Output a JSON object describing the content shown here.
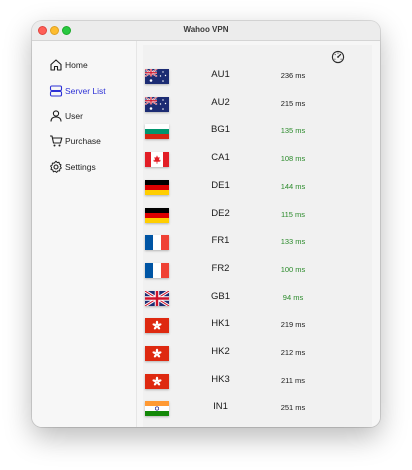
{
  "window": {
    "title": "Wahoo VPN"
  },
  "sidebar": {
    "items": [
      {
        "label": "Home",
        "icon": "home-icon",
        "active": false
      },
      {
        "label": "Server List",
        "icon": "server-icon",
        "active": true
      },
      {
        "label": "User",
        "icon": "user-icon",
        "active": false
      },
      {
        "label": "Purchase",
        "icon": "cart-icon",
        "active": false
      },
      {
        "label": "Settings",
        "icon": "gear-icon",
        "active": false
      }
    ]
  },
  "colors": {
    "accent": "#2d31d6",
    "ping_fast": "#2a8a2a",
    "ping_normal": "#1b1b1b"
  },
  "servers": [
    {
      "name": "AU1",
      "ping": "236 ms",
      "fast": false,
      "country": "au"
    },
    {
      "name": "AU2",
      "ping": "215 ms",
      "fast": false,
      "country": "au"
    },
    {
      "name": "BG1",
      "ping": "135 ms",
      "fast": true,
      "country": "bg"
    },
    {
      "name": "CA1",
      "ping": "108 ms",
      "fast": true,
      "country": "ca"
    },
    {
      "name": "DE1",
      "ping": "144 ms",
      "fast": true,
      "country": "de"
    },
    {
      "name": "DE2",
      "ping": "115 ms",
      "fast": true,
      "country": "de"
    },
    {
      "name": "FR1",
      "ping": "133 ms",
      "fast": true,
      "country": "fr"
    },
    {
      "name": "FR2",
      "ping": "100 ms",
      "fast": true,
      "country": "fr"
    },
    {
      "name": "GB1",
      "ping": "94 ms",
      "fast": true,
      "country": "gb"
    },
    {
      "name": "HK1",
      "ping": "219 ms",
      "fast": false,
      "country": "hk"
    },
    {
      "name": "HK2",
      "ping": "212 ms",
      "fast": false,
      "country": "hk"
    },
    {
      "name": "HK3",
      "ping": "211 ms",
      "fast": false,
      "country": "hk"
    },
    {
      "name": "IN1",
      "ping": "251 ms",
      "fast": false,
      "country": "in"
    }
  ]
}
